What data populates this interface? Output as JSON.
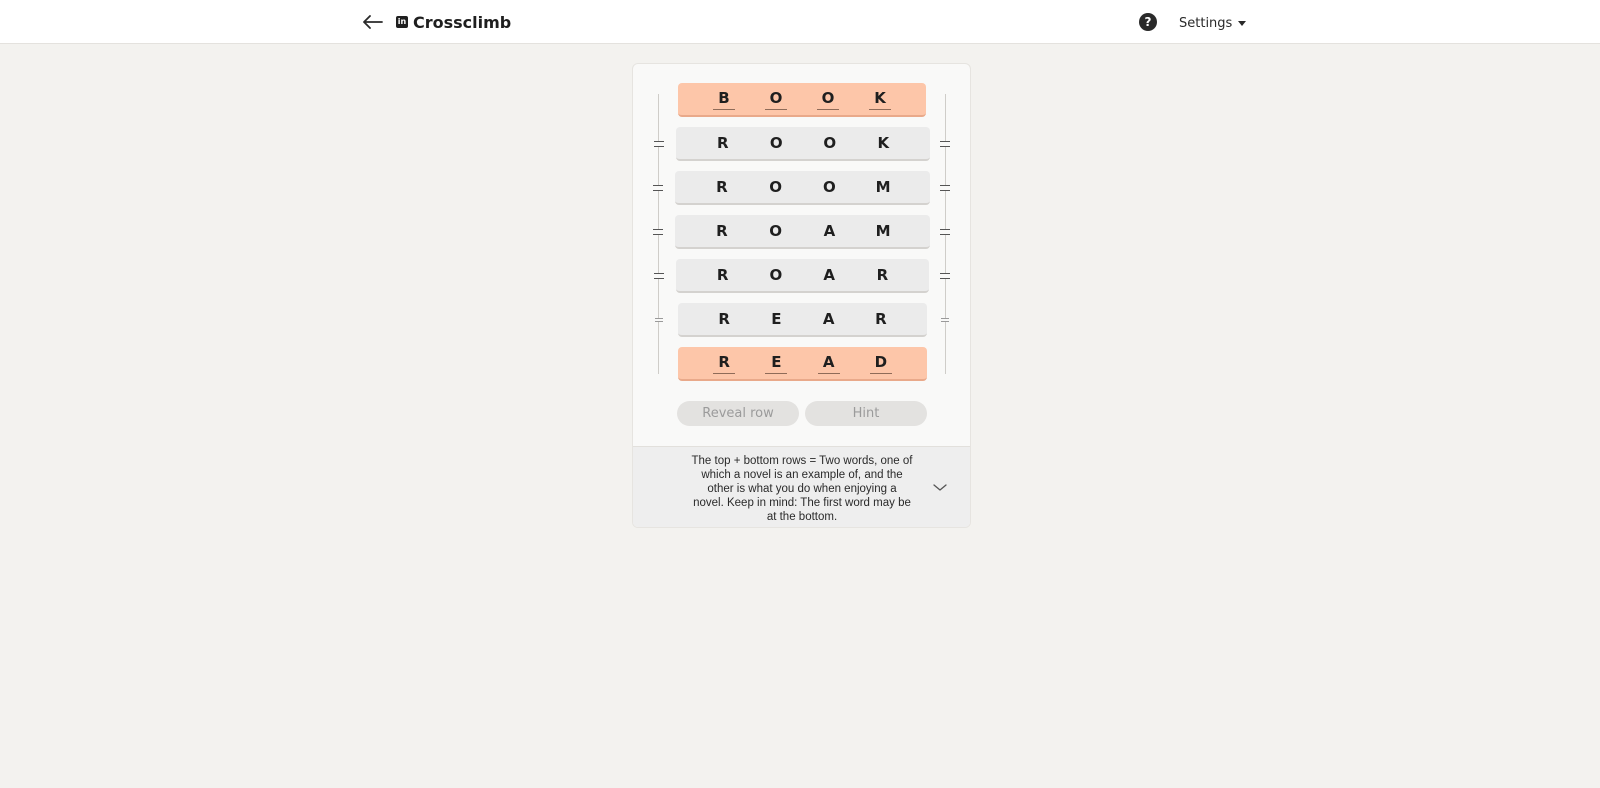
{
  "header": {
    "title": "Crossclimb",
    "logo_glyph": "in",
    "help_glyph": "?",
    "settings_label": "Settings"
  },
  "game": {
    "rows": [
      {
        "letters": [
          "B",
          "O",
          "O",
          "K"
        ],
        "locked": true
      },
      {
        "letters": [
          "R",
          "O",
          "O",
          "K"
        ],
        "locked": false
      },
      {
        "letters": [
          "R",
          "O",
          "O",
          "M"
        ],
        "locked": false
      },
      {
        "letters": [
          "R",
          "O",
          "A",
          "M"
        ],
        "locked": false
      },
      {
        "letters": [
          "R",
          "O",
          "A",
          "R"
        ],
        "locked": false
      },
      {
        "letters": [
          "R",
          "E",
          "A",
          "R"
        ],
        "locked": false
      },
      {
        "letters": [
          "R",
          "E",
          "A",
          "D"
        ],
        "locked": true
      }
    ],
    "reveal_row_label": "Reveal row",
    "hint_label": "Hint",
    "clue": "The top + bottom rows = Two words, one of which a novel is an example of, and the other is what you do when enjoying a novel. Keep in mind: The first word may be at the bottom."
  },
  "colors": {
    "locked_row": "#fdc6a9",
    "row": "#ebebeb",
    "background": "#f3f2ef"
  },
  "icons": {
    "back": "arrow-left-icon",
    "help": "question-circle-icon",
    "settings_caret": "caret-down-icon",
    "drag_handle": "drag-handle-icon",
    "clue_toggle": "chevron-down-icon"
  }
}
